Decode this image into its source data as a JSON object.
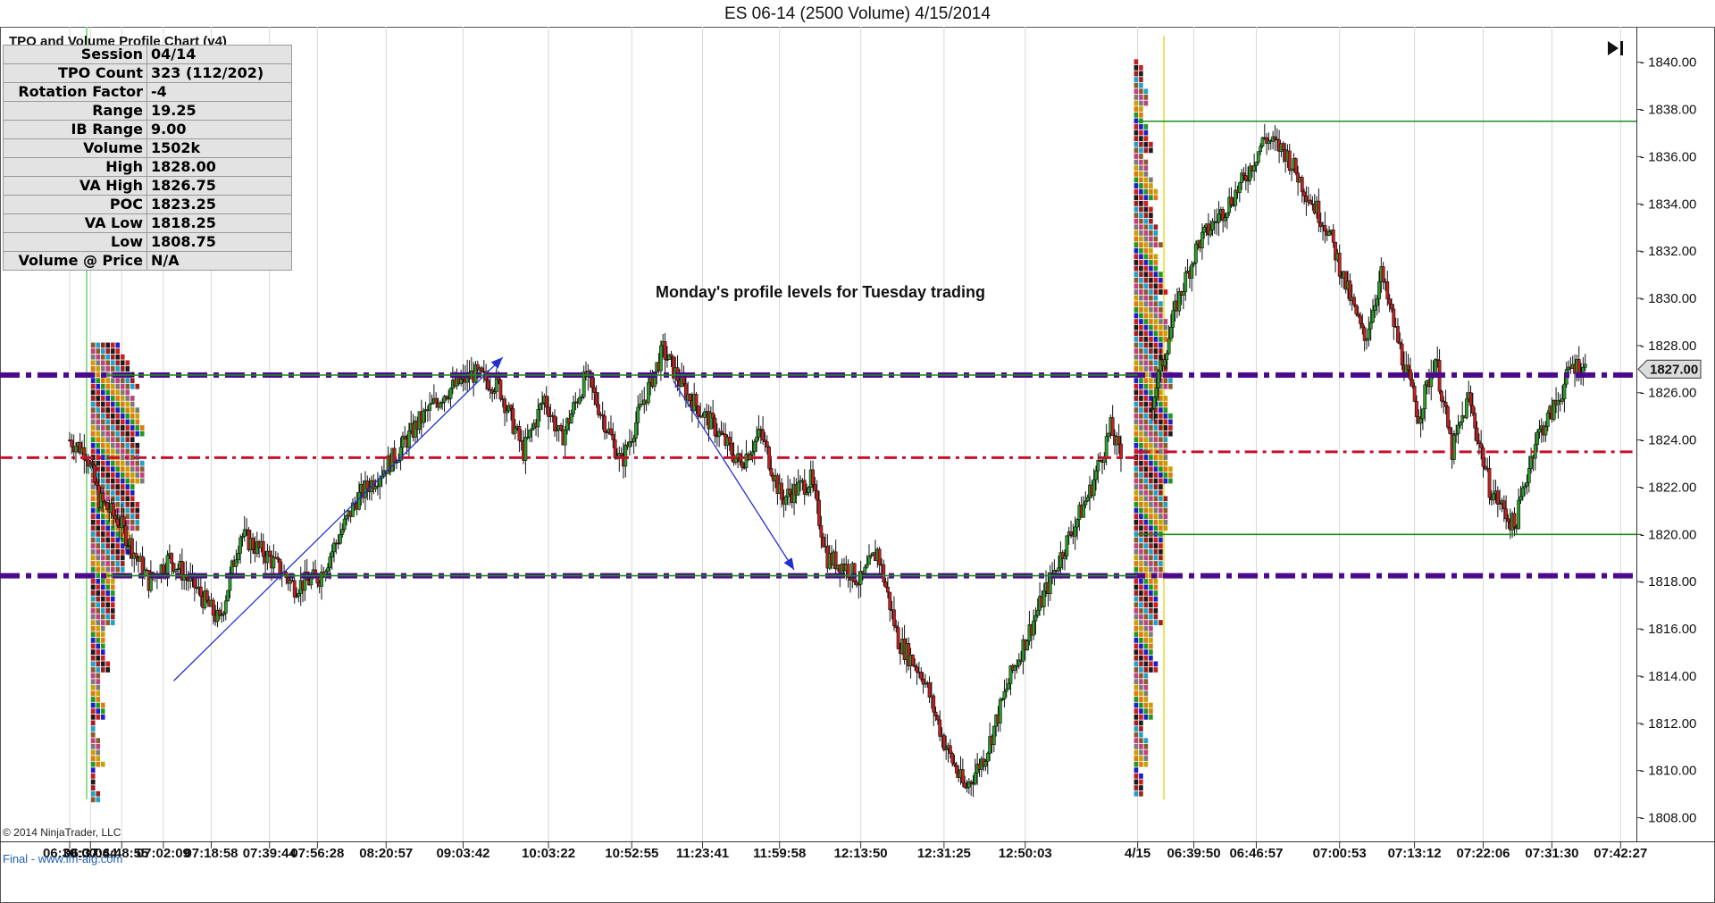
{
  "title": "ES 06-14 (2500 Volume)  4/15/2014",
  "panel": {
    "caption": "TPO and Volume Profile Chart (v4)",
    "rows": [
      {
        "label": "Session",
        "value": "04/14"
      },
      {
        "label": "TPO Count",
        "value": "323 (112/202)"
      },
      {
        "label": "Rotation Factor",
        "value": "-4"
      },
      {
        "label": "Range",
        "value": "19.25"
      },
      {
        "label": "IB Range",
        "value": "9.00"
      },
      {
        "label": "Volume",
        "value": "1502k"
      },
      {
        "label": "High",
        "value": "1828.00"
      },
      {
        "label": "VA High",
        "value": "1826.75"
      },
      {
        "label": "POC",
        "value": "1823.25"
      },
      {
        "label": "VA Low",
        "value": "1818.25"
      },
      {
        "label": "Low",
        "value": "1808.75"
      },
      {
        "label": "Volume @ Price",
        "value": "N/A"
      }
    ]
  },
  "annotation": "Monday's profile levels for Tuesday trading",
  "copyright": "© 2014 NinjaTrader, LLC",
  "footer_note": "Final - www.lm-aig.com",
  "end_button_icon": "skip-to-end-icon",
  "chart_data": {
    "type": "candlestick",
    "y_axis": {
      "min": 1807.0,
      "max": 1841.5,
      "ticks": [
        1808,
        1810,
        1812,
        1814,
        1816,
        1818,
        1820,
        1822,
        1824,
        1826,
        1828,
        1830,
        1832,
        1834,
        1836,
        1838,
        1840
      ],
      "tick_labels": [
        "1808.00",
        "1810.00",
        "1812.00",
        "1814.00",
        "1816.00",
        "1818.00",
        "1820.00",
        "1822.00",
        "1824.00",
        "1826.00",
        "1828.00",
        "1830.00",
        "1832.00",
        "1834.00",
        "1836.00",
        "1838.00",
        "1840.00"
      ],
      "last_price_label": "1827.00",
      "last_price": 1827.0
    },
    "x_labels": [
      "06:30:00",
      "06:37:44",
      "06:48:55",
      "07:02:09",
      "07:18:58",
      "07:39:44",
      "07:56:28",
      "08:20:57",
      "09:03:42",
      "10:03:22",
      "10:52:55",
      "11:23:41",
      "11:59:58",
      "12:13:50",
      "12:31:25",
      "12:50:03",
      "4/15",
      "06:39:50",
      "06:46:57",
      "07:00:53",
      "07:13:12",
      "07:22:06",
      "07:31:30",
      "07:42:27"
    ],
    "x_label_index": [
      0,
      10,
      25,
      45,
      68,
      96,
      119,
      152,
      189,
      230,
      270,
      304,
      341,
      380,
      420,
      459,
      513,
      540,
      570,
      610,
      646,
      679,
      712,
      745
    ],
    "bar_count": 760,
    "session_break_index": 513,
    "price_path": [
      {
        "i": 0,
        "p": 1824.0
      },
      {
        "i": 8,
        "p": 1823.5
      },
      {
        "i": 14,
        "p": 1821.5
      },
      {
        "i": 24,
        "p": 1820.5
      },
      {
        "i": 38,
        "p": 1818.0
      },
      {
        "i": 48,
        "p": 1819.0
      },
      {
        "i": 60,
        "p": 1817.8
      },
      {
        "i": 72,
        "p": 1816.3
      },
      {
        "i": 82,
        "p": 1820.0
      },
      {
        "i": 96,
        "p": 1819.0
      },
      {
        "i": 108,
        "p": 1817.8
      },
      {
        "i": 120,
        "p": 1818.2
      },
      {
        "i": 138,
        "p": 1821.5
      },
      {
        "i": 158,
        "p": 1823.5
      },
      {
        "i": 168,
        "p": 1824.8
      },
      {
        "i": 180,
        "p": 1826.0
      },
      {
        "i": 194,
        "p": 1826.8
      },
      {
        "i": 206,
        "p": 1826.3
      },
      {
        "i": 218,
        "p": 1823.5
      },
      {
        "i": 228,
        "p": 1825.8
      },
      {
        "i": 236,
        "p": 1824.0
      },
      {
        "i": 248,
        "p": 1826.7
      },
      {
        "i": 256,
        "p": 1825.0
      },
      {
        "i": 265,
        "p": 1823.0
      },
      {
        "i": 275,
        "p": 1825.5
      },
      {
        "i": 285,
        "p": 1827.8
      },
      {
        "i": 296,
        "p": 1826.0
      },
      {
        "i": 310,
        "p": 1824.5
      },
      {
        "i": 322,
        "p": 1823.0
      },
      {
        "i": 332,
        "p": 1824.3
      },
      {
        "i": 342,
        "p": 1821.5
      },
      {
        "i": 356,
        "p": 1822.3
      },
      {
        "i": 364,
        "p": 1819.0
      },
      {
        "i": 372,
        "p": 1818.7
      },
      {
        "i": 380,
        "p": 1818.0
      },
      {
        "i": 388,
        "p": 1819.3
      },
      {
        "i": 398,
        "p": 1815.5
      },
      {
        "i": 410,
        "p": 1814.0
      },
      {
        "i": 420,
        "p": 1811.2
      },
      {
        "i": 430,
        "p": 1809.2
      },
      {
        "i": 440,
        "p": 1810.7
      },
      {
        "i": 452,
        "p": 1814.0
      },
      {
        "i": 466,
        "p": 1817.0
      },
      {
        "i": 478,
        "p": 1819.5
      },
      {
        "i": 490,
        "p": 1821.8
      },
      {
        "i": 500,
        "p": 1824.5
      },
      {
        "i": 508,
        "p": 1822.5
      },
      {
        "i": 513,
        "p": 1823.3
      },
      {
        "i": 518,
        "p": 1825.0
      },
      {
        "i": 524,
        "p": 1827.0
      },
      {
        "i": 532,
        "p": 1829.8
      },
      {
        "i": 542,
        "p": 1832.3
      },
      {
        "i": 554,
        "p": 1833.7
      },
      {
        "i": 564,
        "p": 1835.0
      },
      {
        "i": 574,
        "p": 1836.8
      },
      {
        "i": 584,
        "p": 1836.2
      },
      {
        "i": 594,
        "p": 1834.5
      },
      {
        "i": 604,
        "p": 1833.0
      },
      {
        "i": 614,
        "p": 1830.3
      },
      {
        "i": 622,
        "p": 1828.2
      },
      {
        "i": 630,
        "p": 1831.0
      },
      {
        "i": 640,
        "p": 1827.5
      },
      {
        "i": 648,
        "p": 1825.0
      },
      {
        "i": 656,
        "p": 1827.5
      },
      {
        "i": 664,
        "p": 1823.5
      },
      {
        "i": 672,
        "p": 1825.8
      },
      {
        "i": 682,
        "p": 1822.0
      },
      {
        "i": 694,
        "p": 1820.3
      },
      {
        "i": 704,
        "p": 1824.0
      },
      {
        "i": 714,
        "p": 1825.5
      },
      {
        "i": 722,
        "p": 1827.2
      },
      {
        "i": 728,
        "p": 1827.0
      }
    ],
    "levels": [
      {
        "price": 1826.75,
        "style": "thick-dash-dot",
        "color": "#4b0a8c",
        "from_index": 0,
        "to_index": 760
      },
      {
        "price": 1818.25,
        "style": "thick-dash-dot",
        "color": "#4b0a8c",
        "from_index": 0,
        "to_index": 760
      },
      {
        "price": 1823.25,
        "style": "dash-dot",
        "color": "#c8102e",
        "from_index": 0,
        "to_index": 513
      },
      {
        "price": 1823.5,
        "style": "dash-dot",
        "color": "#c8102e",
        "from_index": 513,
        "to_index": 760
      },
      {
        "price": 1826.75,
        "style": "solid-thin",
        "color": "#1e8c1e",
        "from_index": 18,
        "to_index": 513
      },
      {
        "price": 1818.25,
        "style": "solid-thin",
        "color": "#1e8c1e",
        "from_index": 18,
        "to_index": 513
      },
      {
        "price": 1837.5,
        "style": "solid-thin",
        "color": "#1e8c1e",
        "from_index": 513,
        "to_index": 760
      },
      {
        "price": 1820.0,
        "style": "solid-thin",
        "color": "#1e8c1e",
        "from_index": 513,
        "to_index": 760
      }
    ],
    "trend_lines": [
      {
        "from": {
          "i": 50,
          "p": 1813.8
        },
        "to": {
          "i": 208,
          "p": 1827.5
        },
        "color": "#2030d0"
      },
      {
        "from": {
          "i": 290,
          "p": 1826.5
        },
        "to": {
          "i": 348,
          "p": 1818.5
        },
        "color": "#2030d0"
      }
    ],
    "profiles": [
      {
        "index": 18,
        "low": 1808.75,
        "high": 1828.0
      },
      {
        "index": 519,
        "low": 1809.0,
        "high": 1840.0
      }
    ],
    "grid": "vertical"
  }
}
